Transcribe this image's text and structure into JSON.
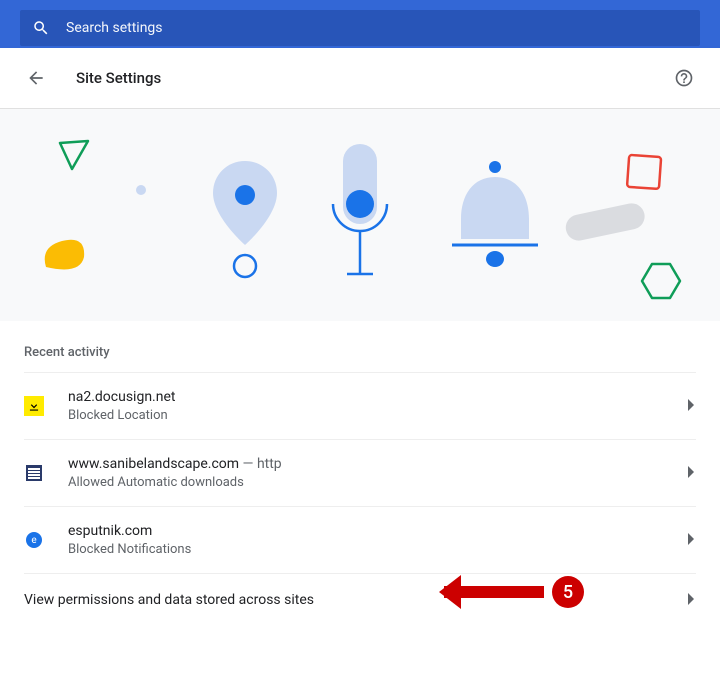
{
  "search": {
    "placeholder": "Search settings"
  },
  "header": {
    "title": "Site Settings"
  },
  "section_title": "Recent activity",
  "rows": [
    {
      "site": "na2.docusign.net",
      "status": "Blocked Location"
    },
    {
      "site": "www.sanibelandscape.com",
      "proto": " — http",
      "status": "Allowed Automatic downloads"
    },
    {
      "site": "esputnik.com",
      "status": "Blocked Notifications"
    }
  ],
  "link_text": "View permissions and data stored across sites",
  "annotation": {
    "number": "5"
  }
}
